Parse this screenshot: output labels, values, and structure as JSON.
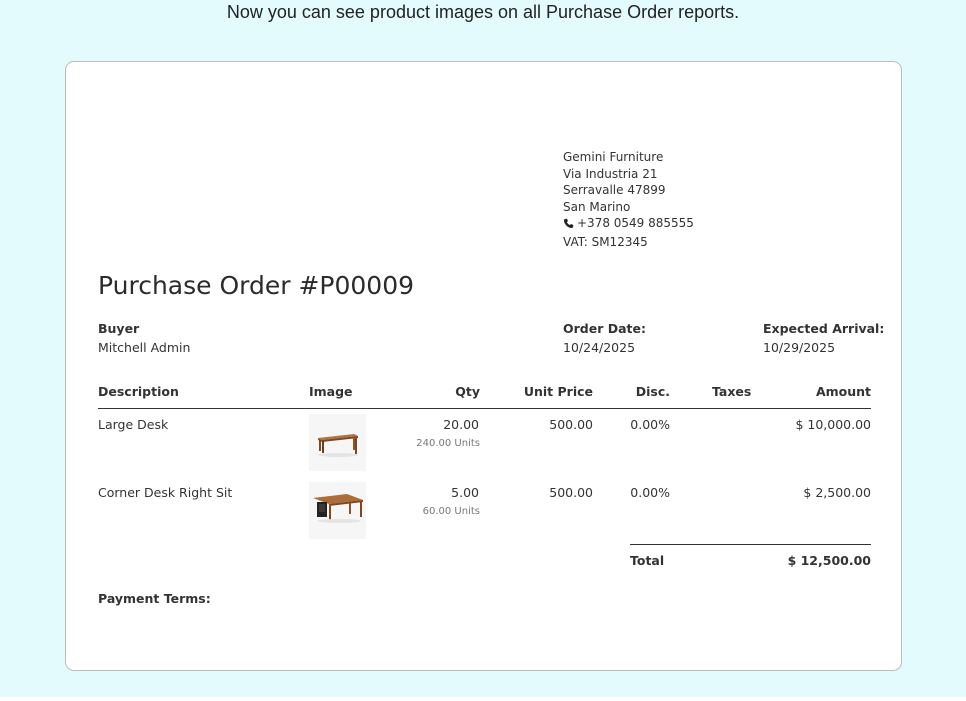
{
  "caption": "Now you can see product images on all Purchase Order reports.",
  "company": {
    "name": "Gemini Furniture",
    "street": "Via Industria 21",
    "city": "Serravalle 47899",
    "country": "San Marino",
    "phone": "+378 0549 885555",
    "vat": "VAT: SM12345"
  },
  "title": "Purchase Order #P00009",
  "buyer": {
    "label": "Buyer",
    "value": "Mitchell Admin"
  },
  "order_date": {
    "label": "Order Date:",
    "value": "10/24/2025"
  },
  "expected_arrival": {
    "label": "Expected Arrival:",
    "value": "10/29/2025"
  },
  "table": {
    "headers": [
      "Description",
      "Image",
      "Qty",
      "Unit Price",
      "Disc.",
      "Taxes",
      "Amount"
    ],
    "rows": [
      {
        "description": "Large Desk",
        "image": "desk-image",
        "qty": "20.00",
        "units": "240.00 Units",
        "unit_price": "500.00",
        "disc": "0.00%",
        "taxes": "",
        "amount": "$ 10,000.00"
      },
      {
        "description": "Corner Desk Right Sit",
        "image": "corner-desk-image",
        "qty": "5.00",
        "units": "60.00 Units",
        "unit_price": "500.00",
        "disc": "0.00%",
        "taxes": "",
        "amount": "$ 2,500.00"
      }
    ]
  },
  "total": {
    "label": "Total",
    "value": "$ 12,500.00"
  },
  "payment_terms": {
    "label": "Payment Terms:"
  },
  "colors": {
    "background": "#e3fbfd",
    "border": "#bdbdbd",
    "wood": "#a0622f"
  }
}
